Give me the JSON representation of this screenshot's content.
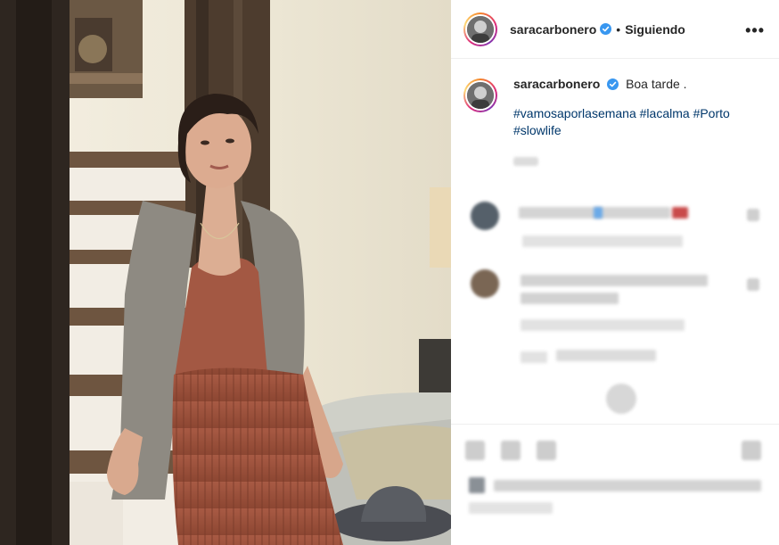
{
  "post": {
    "username": "saracarbonero",
    "follow_separator": "•",
    "follow_status": "Siguiendo",
    "more_label": "•••"
  },
  "caption": {
    "username": "saracarbonero",
    "text": "Boa tarde .",
    "hashtags": [
      "#vamosaporlasemana",
      "#lacalma",
      "#Porto",
      "#slowlife"
    ]
  },
  "colors": {
    "verified_badge": "#3897f0",
    "hashtag": "#00376b",
    "text": "#262626",
    "divider": "#efefef"
  },
  "icons": {
    "verified": "verified-badge-icon",
    "more": "more-options-icon"
  }
}
